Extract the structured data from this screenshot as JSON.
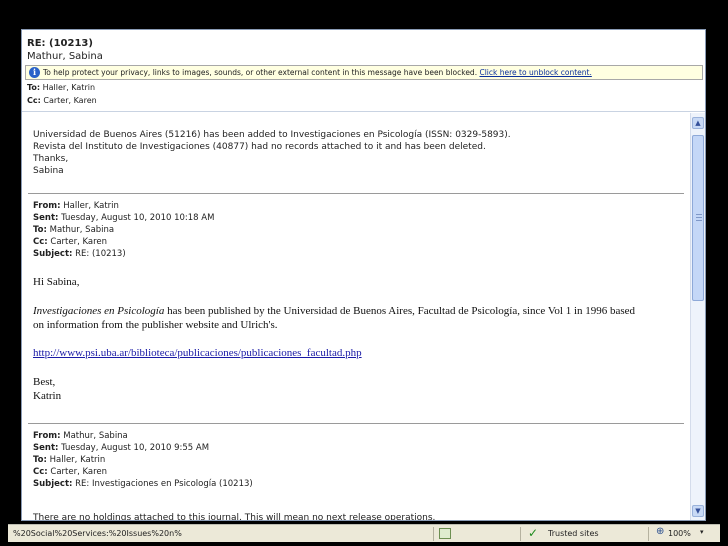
{
  "header": {
    "subject": "RE: (10213)",
    "from": "Mathur, Sabina",
    "infobar": {
      "message": "To help protect your privacy, links to images, sounds, or other external content in this message have been blocked.",
      "link": "Click here to unblock content."
    },
    "to_label": "To:",
    "to_value": "Haller, Katrin",
    "cc_label": "Cc:",
    "cc_value": "Carter, Karen"
  },
  "body": {
    "reply_lines": [
      "Universidad de Buenos Aires (51216) has been added to Investigaciones en Psicología (ISSN: 0329-5893).",
      "Revista del Instituto de Investigaciones (40877) had no records attached to it and has been deleted.",
      "Thanks,",
      "Sabina"
    ],
    "quote1": {
      "from_label": "From:",
      "from_value": "Haller, Katrin",
      "sent_label": "Sent:",
      "sent_value": "Tuesday, August 10, 2010 10:18 AM",
      "to_label": "To:",
      "to_value": "Mathur, Sabina",
      "cc_label": "Cc:",
      "cc_value": "Carter, Karen",
      "subject_label": "Subject:",
      "subject_value": "RE: (10213)",
      "greeting": "Hi Sabina,",
      "para_italic": "Investigaciones en Psicología",
      "para_rest": " has been published by the Universidad de Buenos Aires, Facultad de Psicología, since Vol 1 in 1996 based",
      "para_line2": "on information from the publisher website and Ulrich's.",
      "url": "http://www.psi.uba.ar/biblioteca/publicaciones/publicaciones_facultad.php",
      "closing": "Best,",
      "signature": "Katrin"
    },
    "quote2": {
      "from_label": "From:",
      "from_value": "Mathur, Sabina",
      "sent_label": "Sent:",
      "sent_value": "Tuesday, August 10, 2010 9:55 AM",
      "to_label": "To:",
      "to_value": "Haller, Katrin",
      "cc_label": "Cc:",
      "cc_value": "Carter, Karen",
      "subject_label": "Subject:",
      "subject_value": "RE: Investigaciones en Psicología (10213)",
      "cut_line": "There are no holdings attached to this journal. This will mean no next release operations."
    }
  },
  "statusbar": {
    "url": "%20Social%20Services:%20Issues%20n%",
    "trusted": "Trusted sites",
    "zoom": "100%"
  },
  "colors": {
    "infobar_bg": "#ffffe1",
    "link": "#0a2f9c",
    "accent_scroll": "#c4d7f7"
  }
}
